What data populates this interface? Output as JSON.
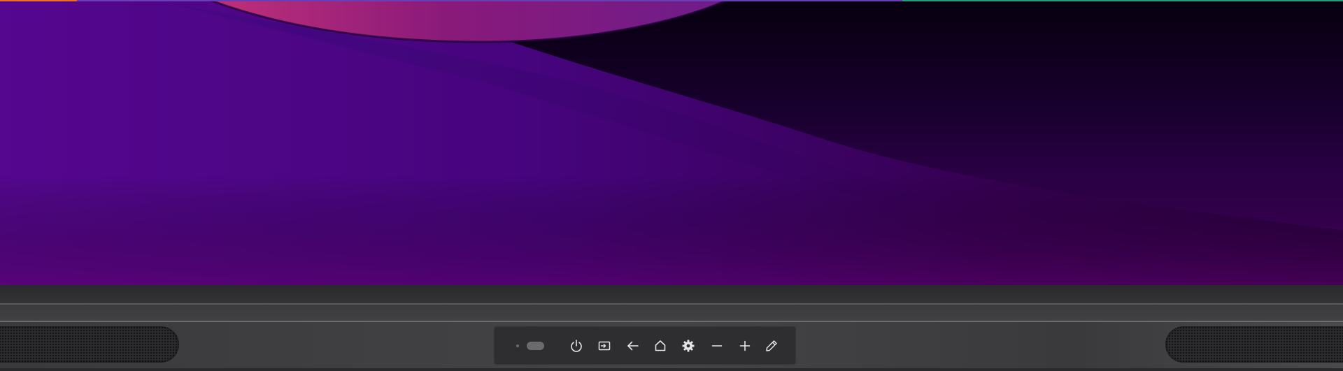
{
  "device": {
    "type": "interactive-flat-panel-display",
    "top_strip_colors": [
      "#e8702a",
      "#6a3fb5",
      "#e8702a",
      "#1aa37a"
    ]
  },
  "wallpaper": {
    "colors": {
      "left": "#55078f",
      "center": "#46047d",
      "right": "#2a0040",
      "arc": "#a0208a",
      "shadow": "#0a0014"
    }
  },
  "control_panel": {
    "buttons": [
      {
        "name": "power-button",
        "icon": "power-icon"
      },
      {
        "name": "input-source-button",
        "icon": "input-source-icon"
      },
      {
        "name": "back-button",
        "icon": "back-arrow-icon"
      },
      {
        "name": "home-button",
        "icon": "home-icon"
      },
      {
        "name": "settings-button",
        "icon": "gear-icon"
      },
      {
        "name": "volume-down-button",
        "icon": "minus-icon"
      },
      {
        "name": "volume-up-button",
        "icon": "plus-icon"
      },
      {
        "name": "annotate-button",
        "icon": "pen-icon"
      }
    ],
    "icon_color": "#e6e6e6"
  }
}
